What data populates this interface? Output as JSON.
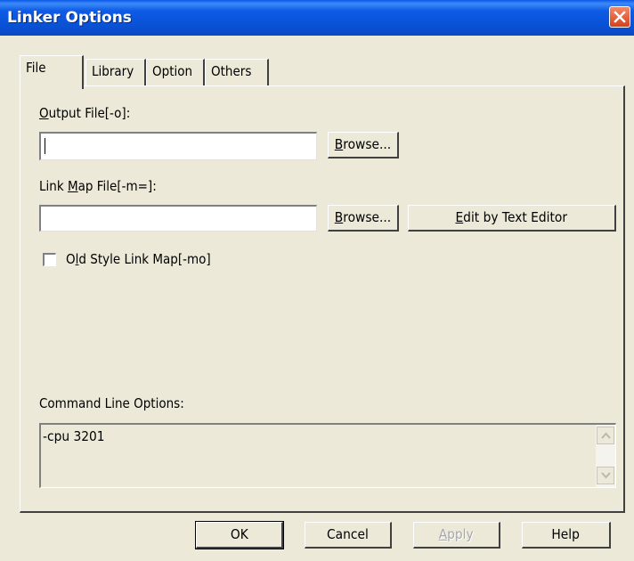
{
  "window": {
    "title": "Linker Options"
  },
  "tabs": [
    {
      "label": "File"
    },
    {
      "label": "Library"
    },
    {
      "label": "Option"
    },
    {
      "label": "Others"
    }
  ],
  "file_tab": {
    "output_file": {
      "label_prefix": "",
      "label_mnemonic": "O",
      "label_suffix": "utput File[-o]:",
      "value": ""
    },
    "link_map_file": {
      "label_prefix": "Link ",
      "label_mnemonic": "M",
      "label_suffix": "ap File[-m=]:",
      "value": ""
    },
    "browse_label_mnemonic": "B",
    "browse_label_suffix": "rowse...",
    "edit_button": {
      "mnemonic": "E",
      "suffix": "dit by Text Editor"
    },
    "old_style_checkbox": {
      "prefix": "O",
      "mnemonic": "l",
      "suffix": "d Style Link Map[-mo]",
      "checked": false
    },
    "command_line": {
      "label": "Command Line Options:",
      "value": "-cpu 3201"
    }
  },
  "buttons": {
    "ok": "OK",
    "cancel": "Cancel",
    "apply_mnemonic": "A",
    "apply_suffix": "pply",
    "help": "Help"
  },
  "icons": {
    "close": "close-icon",
    "scroll_up": "chevron-up-icon",
    "scroll_down": "chevron-down-icon"
  }
}
